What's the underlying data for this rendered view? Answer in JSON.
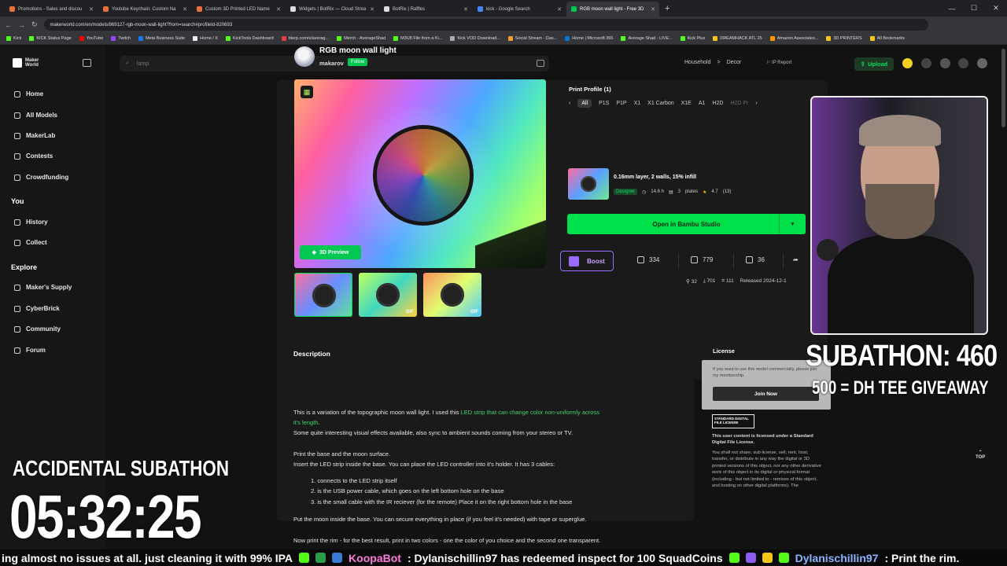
{
  "browser": {
    "tabs": [
      {
        "label": "Promotions - Sales and discou",
        "color": "#e8703a"
      },
      {
        "label": "Youtube Keychain: Custom Na",
        "color": "#e8703a"
      },
      {
        "label": "Custom 3D Printed LED Name",
        "color": "#e8703a"
      },
      {
        "label": "Widgets | BotRix — Cloud Strea",
        "color": "#dddddd"
      },
      {
        "label": "BotRix | Raffles",
        "color": "#dddddd"
      },
      {
        "label": "kick - Google Search",
        "color": "#4285f4"
      },
      {
        "label": "RGB moon wall light - Free 3D",
        "color": "#00c853"
      }
    ],
    "url": "makerworld.com/en/models/869127-rgb-moon-wall-light?from=search#profileId-820693",
    "bookmarks": [
      "Kick",
      "KICK Status Page",
      "YouTube",
      "Twitch",
      "Meta Business Suite",
      "Home / X",
      "KickTools Dashboard",
      "blerp.com/x/averag...",
      "Merch - AverageShad",
      "M3U8 File from a Ki...",
      "Kick VOD Download...",
      "Social Stream - Das...",
      "Home | Microsoft 365",
      "Average Shad - LIVE...",
      "Kick Plus",
      "DREAMHACK ATL 25",
      "Amazon Associates...",
      "3D PRINTERS",
      "All Bookmarks"
    ]
  },
  "site": {
    "logo_line1": "Maker",
    "logo_line2": "World",
    "search_placeholder": "lamp",
    "upload_label": "Upload",
    "nav": [
      {
        "label": "Home",
        "icon": "home-icon"
      },
      {
        "label": "All Models",
        "icon": "models-icon"
      },
      {
        "label": "MakerLab",
        "icon": "lab-icon"
      },
      {
        "label": "Contests",
        "icon": "trophy-icon"
      },
      {
        "label": "Crowdfunding",
        "icon": "crowdfunding-icon"
      }
    ],
    "you_header": "You",
    "you_items": [
      {
        "label": "History",
        "icon": "history-icon"
      },
      {
        "label": "Collect",
        "icon": "collect-icon"
      }
    ],
    "explore_header": "Explore",
    "explore_items": [
      {
        "label": "Maker's Supply",
        "icon": "supply-icon"
      },
      {
        "label": "CyberBrick",
        "icon": "cyberbrick-icon"
      },
      {
        "label": "Community",
        "icon": "community-icon"
      },
      {
        "label": "Forum",
        "icon": "forum-icon"
      }
    ]
  },
  "model": {
    "title": "RGB moon wall light",
    "author": "makarov",
    "follow_label": "Follow",
    "breadcrumb": [
      "Household",
      ">",
      "Decor"
    ],
    "ip_report": "IP Report",
    "preview_3d": "3D Preview",
    "thumb_gif": "GIF"
  },
  "print_profile": {
    "title": "Print Profile (1)",
    "filters": [
      "All",
      "P1S",
      "P1P",
      "X1",
      "X1 Carbon",
      "X1E",
      "A1",
      "H2D",
      "H2D Pr"
    ],
    "profile_name": "0.16mm layer, 2 walls, 15% infill",
    "designer_badge": "Designer",
    "print_time": "14.6 h",
    "plates": "3",
    "plates_label": "plates",
    "rating": "4.7",
    "rating_count": "(13)",
    "open_label": "Open in Bambu Studio",
    "boost_label": "Boost",
    "likes": "334",
    "collects": "779",
    "comments": "36",
    "downloads_a": "32",
    "downloads_b": "701",
    "prints": "111",
    "released": "Released 2024-12-1"
  },
  "description": {
    "heading": "Description",
    "line1_a": "This is a variation of the topographic moon wall light. I used this ",
    "line1_link": "LED strip that can change color non-uniformly across",
    "line2_link": "it's length",
    "line2_b": ".",
    "line3": "Some quite interesting visual effects available, also sync to ambient sounds coming from your stereo or TV.",
    "line4": "Print the base and the moon surface.",
    "line5": "Insert the LED strip inside the base. You can place the LED controller into it's holder. It has 3 cables:",
    "list": [
      "1. connects to the LED strip itself",
      "2. is the USB power cable, which goes on the left bottom hole on the base",
      "3. is the small cable with the IR reciever (for the remote) Place it on the right bottom hole in the base"
    ],
    "line6": "Put the moon inside the base. You can secure everything in place (if you feel it's needed) with tape or superglue.",
    "line7": "Now print the rim - for the best result, print in two colors - one the color of you choice and the second one transparent."
  },
  "license": {
    "heading": "License",
    "prompt": "If you want to use this model commercially, please join my membership.",
    "join_label": "Join Now",
    "badge": "STANDARD DIGITAL FILE LICENSE",
    "desc1": "This user content is licensed under a Standard Digital File License.",
    "desc2": "You shall not share, sub-license, sell, rent, host, transfer, or distribute in any way the digital or 3D printed versions of this object, nor any other derivative work of this object in its digital or physical format (including - but not limited to - remixes of this object, and hosting on other digital platforms). The"
  },
  "totop": "TOP",
  "overlay": {
    "subathon": "SUBATHON: 460",
    "goal": "500 = DH TEE GIVEAWAY",
    "accidental": "ACCIDENTAL SUBATHON",
    "timer": "05:32:25",
    "ticker_a": "ing almost no issues at all. just cleaning it with 99% IPA",
    "ticker_bot": "KoopaBot",
    "ticker_b": ": Dylanischillin97 has redeemed inspect for 100 SquadCoins",
    "ticker_user": "Dylanischillin97",
    "ticker_c": ": Print the rim."
  },
  "colors": {
    "accent": "#00e04a",
    "boost": "#9a6bff",
    "link": "#3cd46a"
  }
}
